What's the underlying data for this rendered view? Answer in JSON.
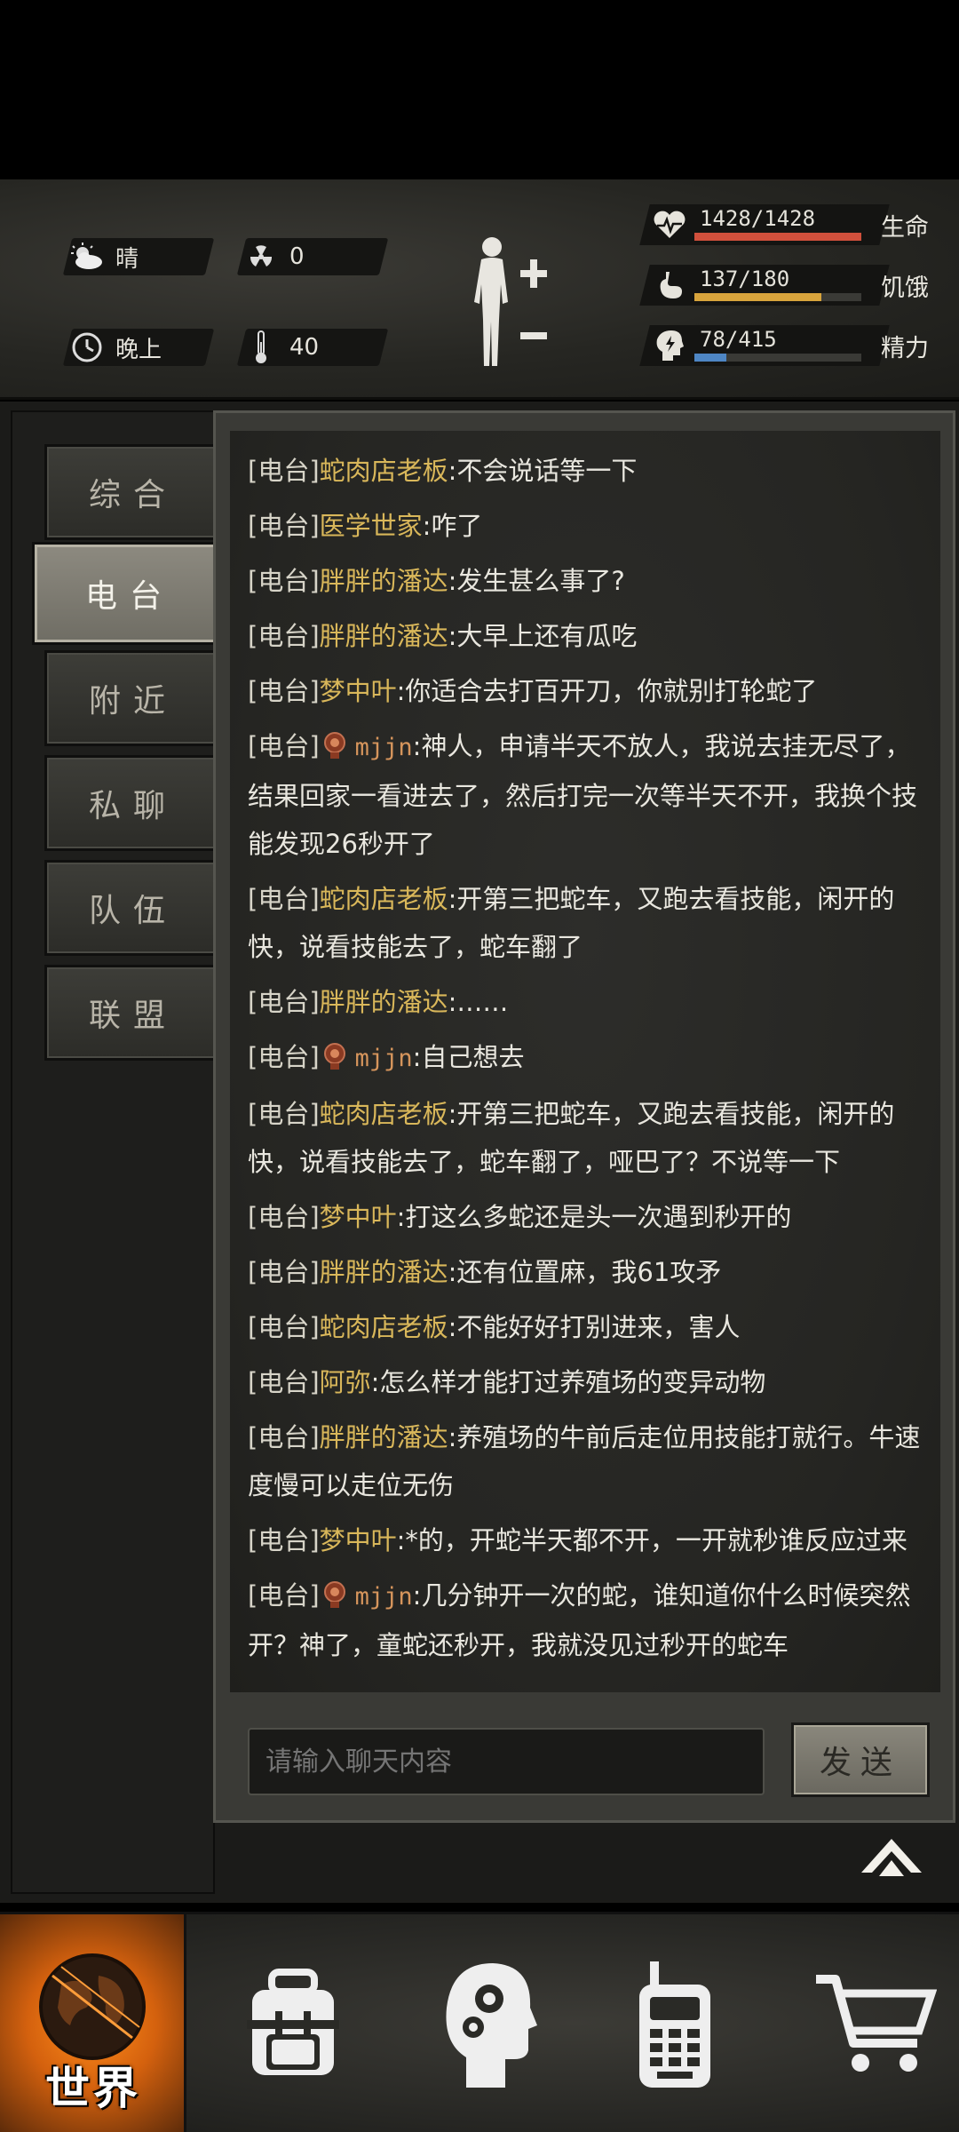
{
  "status": {
    "weather": "晴",
    "radiation": "0",
    "time_of_day": "晚上",
    "temperature": "40"
  },
  "vitals": {
    "health": {
      "text": "1428/1428",
      "label": "生命",
      "fraction": 1.0,
      "color": "#d0503c"
    },
    "hunger": {
      "text": "137/180",
      "label": "饥饿",
      "fraction": 0.76,
      "color": "#d8a43c"
    },
    "energy": {
      "text": "78/415",
      "label": "精力",
      "fraction": 0.19,
      "color": "#4e86c4"
    }
  },
  "tabs": [
    {
      "label": "综合"
    },
    {
      "label": "电台"
    },
    {
      "label": "附近"
    },
    {
      "label": "私聊"
    },
    {
      "label": "队伍"
    },
    {
      "label": "联盟"
    }
  ],
  "chat": {
    "messages": [
      {
        "channel": "[电台]",
        "name": "蛇肉店老板",
        "text": ":不会说话等一下"
      },
      {
        "channel": "[电台]",
        "name": "医学世家",
        "text": ":咋了"
      },
      {
        "channel": "[电台]",
        "name": "胖胖的潘达",
        "text": ":发生甚么事了?"
      },
      {
        "channel": "[电台]",
        "name": "胖胖的潘达",
        "text": ":大早上还有瓜吃"
      },
      {
        "channel": "[电台]",
        "name": "梦中叶",
        "text": ":你适合去打百开刀，你就别打轮蛇了"
      },
      {
        "channel": "[电台]",
        "name": "mjjn",
        "avatar": true,
        "text": ":神人，申请半天不放人，我说去挂无尽了，结果回家一看进去了，然后打完一次等半天不开，我换个技能发现26秒开了"
      },
      {
        "channel": "[电台]",
        "name": "蛇肉店老板",
        "text": ":开第三把蛇车，又跑去看技能，闲开的快，说看技能去了，蛇车翻了"
      },
      {
        "channel": "[电台]",
        "name": "胖胖的潘达",
        "text": ":……"
      },
      {
        "channel": "[电台]",
        "name": "mjjn",
        "avatar": true,
        "text": ":自己想去"
      },
      {
        "channel": "[电台]",
        "name": "蛇肉店老板",
        "text": ":开第三把蛇车，又跑去看技能，闲开的快，说看技能去了，蛇车翻了，哑巴了？不说等一下"
      },
      {
        "channel": "[电台]",
        "name": "梦中叶",
        "text": ":打这么多蛇还是头一次遇到秒开的"
      },
      {
        "channel": "[电台]",
        "name": "胖胖的潘达",
        "text": ":还有位置麻，我61攻矛"
      },
      {
        "channel": "[电台]",
        "name": "蛇肉店老板",
        "text": ":不能好好打别进来，害人"
      },
      {
        "channel": "[电台]",
        "name": "阿弥",
        "text": ":怎么样才能打过养殖场的变异动物"
      },
      {
        "channel": "[电台]",
        "name": "胖胖的潘达",
        "text": ":养殖场的牛前后走位用技能打就行。牛速度慢可以走位无伤"
      },
      {
        "channel": "[电台]",
        "name": "梦中叶",
        "text": ":*的，开蛇半天都不开，一开就秒谁反应过来"
      },
      {
        "channel": "[电台]",
        "name": "mjjn",
        "avatar": true,
        "text": ":几分钟开一次的蛇，谁知道你什么时候突然开？神了，童蛇还秒开，我就没见过秒开的蛇车"
      }
    ],
    "input_placeholder": "请输入聊天内容",
    "send_label": "发送"
  },
  "nav": {
    "world_label": "世界",
    "items": [
      "backpack-icon",
      "skills-head-icon",
      "radio-phone-icon",
      "shop-cart-icon"
    ]
  }
}
